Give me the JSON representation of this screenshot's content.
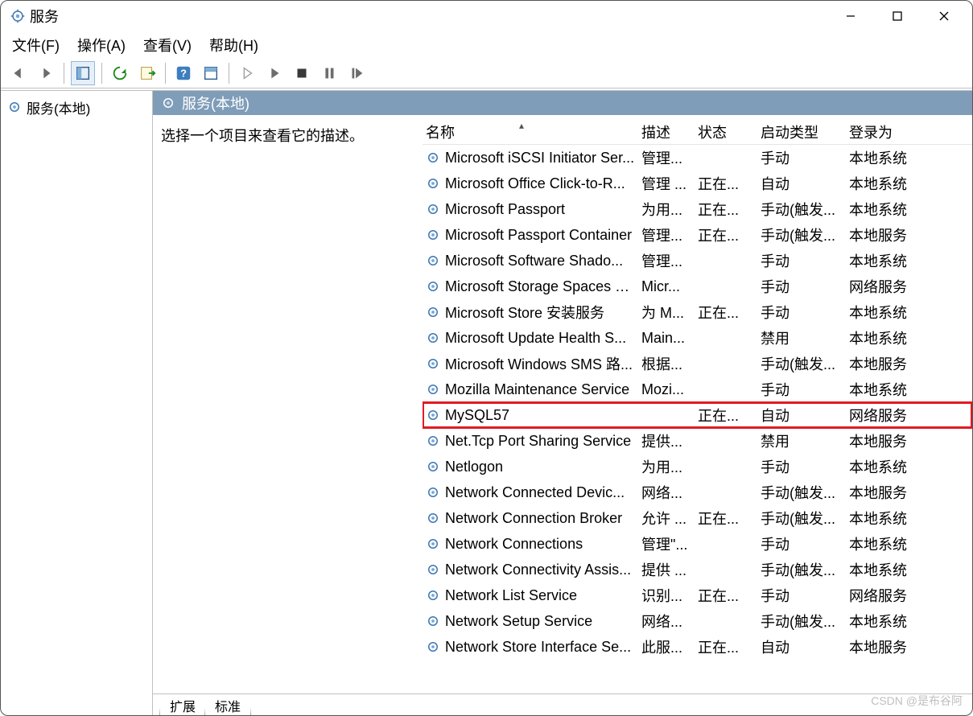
{
  "window_title": "服务",
  "menubar": [
    "文件(F)",
    "操作(A)",
    "查看(V)",
    "帮助(H)"
  ],
  "tree": {
    "root": "服务(本地)"
  },
  "right": {
    "header": "服务(本地)",
    "description": "选择一个项目来查看它的描述。"
  },
  "columns": {
    "name": "名称",
    "desc": "描述",
    "status": "状态",
    "startup": "启动类型",
    "logon": "登录为"
  },
  "services": [
    {
      "name": "Microsoft iSCSI Initiator Ser...",
      "desc": "管理...",
      "status": "",
      "startup": "手动",
      "logon": "本地系统",
      "hl": false
    },
    {
      "name": "Microsoft Office Click-to-R...",
      "desc": "管理 ...",
      "status": "正在...",
      "startup": "自动",
      "logon": "本地系统",
      "hl": false
    },
    {
      "name": "Microsoft Passport",
      "desc": "为用...",
      "status": "正在...",
      "startup": "手动(触发...",
      "logon": "本地系统",
      "hl": false
    },
    {
      "name": "Microsoft Passport Container",
      "desc": "管理...",
      "status": "正在...",
      "startup": "手动(触发...",
      "logon": "本地服务",
      "hl": false
    },
    {
      "name": "Microsoft Software Shado...",
      "desc": "管理...",
      "status": "",
      "startup": "手动",
      "logon": "本地系统",
      "hl": false
    },
    {
      "name": "Microsoft Storage Spaces S...",
      "desc": "Micr...",
      "status": "",
      "startup": "手动",
      "logon": "网络服务",
      "hl": false
    },
    {
      "name": "Microsoft Store 安装服务",
      "desc": "为 M...",
      "status": "正在...",
      "startup": "手动",
      "logon": "本地系统",
      "hl": false
    },
    {
      "name": "Microsoft Update Health S...",
      "desc": "Main...",
      "status": "",
      "startup": "禁用",
      "logon": "本地系统",
      "hl": false
    },
    {
      "name": "Microsoft Windows SMS 路...",
      "desc": "根据...",
      "status": "",
      "startup": "手动(触发...",
      "logon": "本地服务",
      "hl": false
    },
    {
      "name": "Mozilla Maintenance Service",
      "desc": "Mozi...",
      "status": "",
      "startup": "手动",
      "logon": "本地系统",
      "hl": false
    },
    {
      "name": "MySQL57",
      "desc": "",
      "status": "正在...",
      "startup": "自动",
      "logon": "网络服务",
      "hl": true
    },
    {
      "name": "Net.Tcp Port Sharing Service",
      "desc": "提供...",
      "status": "",
      "startup": "禁用",
      "logon": "本地服务",
      "hl": false
    },
    {
      "name": "Netlogon",
      "desc": "为用...",
      "status": "",
      "startup": "手动",
      "logon": "本地系统",
      "hl": false
    },
    {
      "name": "Network Connected Devic...",
      "desc": "网络...",
      "status": "",
      "startup": "手动(触发...",
      "logon": "本地服务",
      "hl": false
    },
    {
      "name": "Network Connection Broker",
      "desc": "允许 ...",
      "status": "正在...",
      "startup": "手动(触发...",
      "logon": "本地系统",
      "hl": false
    },
    {
      "name": "Network Connections",
      "desc": "管理\"...",
      "status": "",
      "startup": "手动",
      "logon": "本地系统",
      "hl": false
    },
    {
      "name": "Network Connectivity Assis...",
      "desc": "提供 ...",
      "status": "",
      "startup": "手动(触发...",
      "logon": "本地系统",
      "hl": false
    },
    {
      "name": "Network List Service",
      "desc": "识别...",
      "status": "正在...",
      "startup": "手动",
      "logon": "网络服务",
      "hl": false
    },
    {
      "name": "Network Setup Service",
      "desc": "网络...",
      "status": "",
      "startup": "手动(触发...",
      "logon": "本地系统",
      "hl": false
    },
    {
      "name": "Network Store Interface Se...",
      "desc": "此服...",
      "status": "正在...",
      "startup": "自动",
      "logon": "本地服务",
      "hl": false
    }
  ],
  "tabs": {
    "extended": "扩展",
    "standard": "标准"
  },
  "watermark": "CSDN @是布谷阿"
}
